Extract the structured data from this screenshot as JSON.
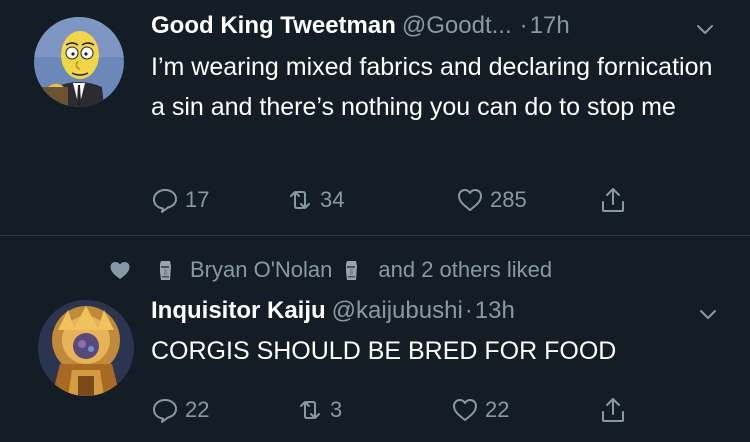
{
  "tweets": [
    {
      "name": "Good King Tweetman",
      "handle": "@Goodt...",
      "dot": "·",
      "time": "17h",
      "text": "I’m wearing mixed fabrics and declaring fornication a sin and there’s nothing you can do to stop me",
      "replies": "17",
      "retweets": "34",
      "likes": "285"
    },
    {
      "name": "Inquisitor Kaiju",
      "handle": "@kaijubushi",
      "dot": "·",
      "time": "13h",
      "text": "CORGIS SHOULD BE BRED FOR FOOD",
      "replies": "22",
      "retweets": "3",
      "likes": "22"
    }
  ],
  "social_context": {
    "liker": "Bryan O'Nolan",
    "others": "and 2 others liked"
  },
  "colors": {
    "background": "#141d26",
    "text": "#ffffff",
    "muted": "#8899a6",
    "divider": "#2f3c4a"
  },
  "icons": [
    "reply-icon",
    "retweet-icon",
    "like-icon",
    "share-icon",
    "chevron-down-icon",
    "moai-icon"
  ]
}
